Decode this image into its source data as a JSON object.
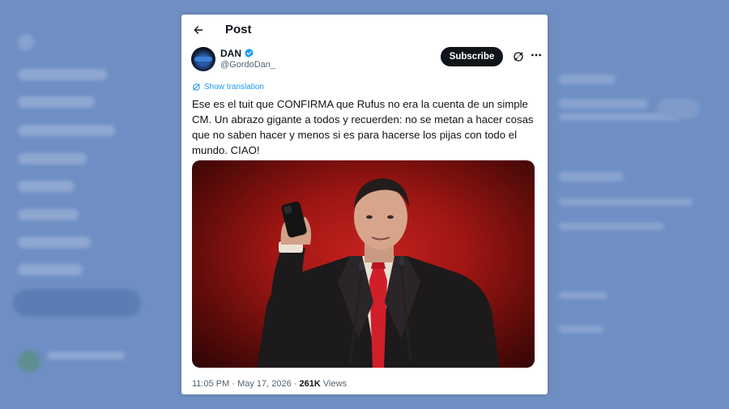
{
  "header": {
    "title": "Post"
  },
  "author": {
    "name": "DAN",
    "handle": "@GordoDan_"
  },
  "actions": {
    "subscribe_label": "Subscribe"
  },
  "translate": {
    "label": "Show translation"
  },
  "post": {
    "text": "Ese es el tuit que CONFIRMA que Rufus no era la cuenta de un simple CM. Un abrazo gigante a todos y recuerden: no se metan a hacer cosas que no saben hacer y menos si es para hacerse los pijas con todo el mundo. CIAO!",
    "time": "11:05 PM",
    "separator": "·",
    "date": "May 17, 2026",
    "views_count": "261K",
    "views_label": "Views"
  },
  "colors": {
    "background": "#6f8fc4",
    "accent": "#1d9bf0",
    "button": "#0f1419",
    "tie": "#d11f2a"
  },
  "icons": [
    "back-arrow-icon",
    "verified-badge-icon",
    "grok-icon",
    "more-icon",
    "translate-icon"
  ]
}
